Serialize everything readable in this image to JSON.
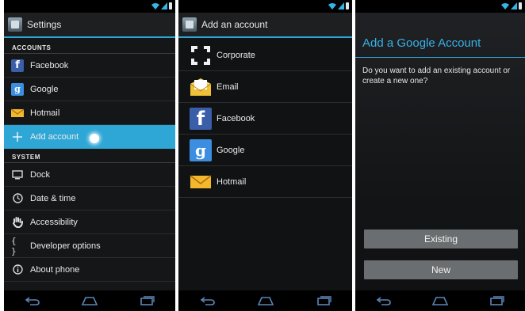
{
  "screen1": {
    "title": "Settings",
    "sections": {
      "accounts": "ACCOUNTS",
      "system": "SYSTEM"
    },
    "items": [
      {
        "label": "Facebook",
        "icon": "facebook-icon"
      },
      {
        "label": "Google",
        "icon": "google-icon"
      },
      {
        "label": "Hotmail",
        "icon": "hotmail-icon"
      },
      {
        "label": "Add account",
        "icon": "plus-icon",
        "selected": true
      },
      {
        "label": "Dock",
        "icon": "dock-icon"
      },
      {
        "label": "Date & time",
        "icon": "clock-icon"
      },
      {
        "label": "Accessibility",
        "icon": "hand-icon"
      },
      {
        "label": "Developer options",
        "icon": "braces-icon"
      },
      {
        "label": "About phone",
        "icon": "info-icon"
      }
    ]
  },
  "screen2": {
    "title": "Add an account",
    "items": [
      {
        "label": "Corporate",
        "icon": "corporate-icon"
      },
      {
        "label": "Email",
        "icon": "email-icon"
      },
      {
        "label": "Facebook",
        "icon": "facebook-icon"
      },
      {
        "label": "Google",
        "icon": "google-icon"
      },
      {
        "label": "Hotmail",
        "icon": "hotmail-icon"
      }
    ]
  },
  "screen3": {
    "title": "Add a Google Account",
    "body": "Do you want to add an existing account or create a new one?",
    "buttons": {
      "existing": "Existing",
      "new": "New"
    }
  },
  "colors": {
    "accent": "#2fa7d6",
    "title_blue": "#37b2e6",
    "facebook": "#3b5ea8",
    "google": "#3b8ee0",
    "hotmail": "#f3b72e"
  }
}
